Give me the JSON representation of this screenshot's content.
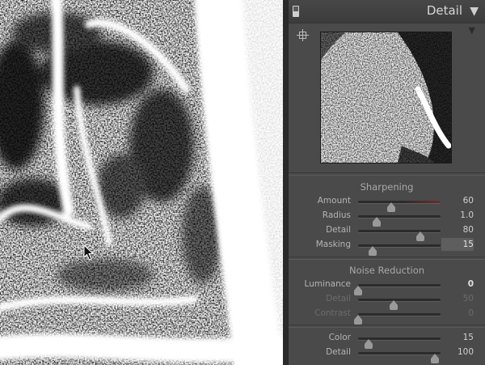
{
  "panel": {
    "title": "Detail",
    "collapse_icon": "triangle-down-icon",
    "target_icon": "target-adjustment-icon",
    "preview_menu_icon": "triangle-down-icon"
  },
  "sharpening": {
    "title": "Sharpening",
    "sliders": [
      {
        "key": "amount",
        "label": "Amount",
        "value": "60",
        "fraction": 0.4,
        "track": "red"
      },
      {
        "key": "radius",
        "label": "Radius",
        "value": "1.0",
        "fraction": 0.23
      },
      {
        "key": "detail",
        "label": "Detail",
        "value": "80",
        "fraction": 0.75
      },
      {
        "key": "masking",
        "label": "Masking",
        "value": "15",
        "fraction": 0.18,
        "active": true
      }
    ]
  },
  "noise_reduction": {
    "title": "Noise Reduction",
    "sliders": [
      {
        "key": "luminance",
        "label": "Luminance",
        "value": "0",
        "fraction": 0.0,
        "bold": true
      },
      {
        "key": "nr-detail",
        "label": "Detail",
        "value": "50",
        "fraction": 0.43,
        "dim": true
      },
      {
        "key": "contrast",
        "label": "Contrast",
        "value": "0",
        "fraction": 0.0,
        "dim": true
      },
      {
        "key": "color",
        "label": "Color",
        "value": "15",
        "fraction": 0.13
      },
      {
        "key": "color-detail",
        "label": "Detail",
        "value": "100",
        "fraction": 0.93
      }
    ]
  }
}
